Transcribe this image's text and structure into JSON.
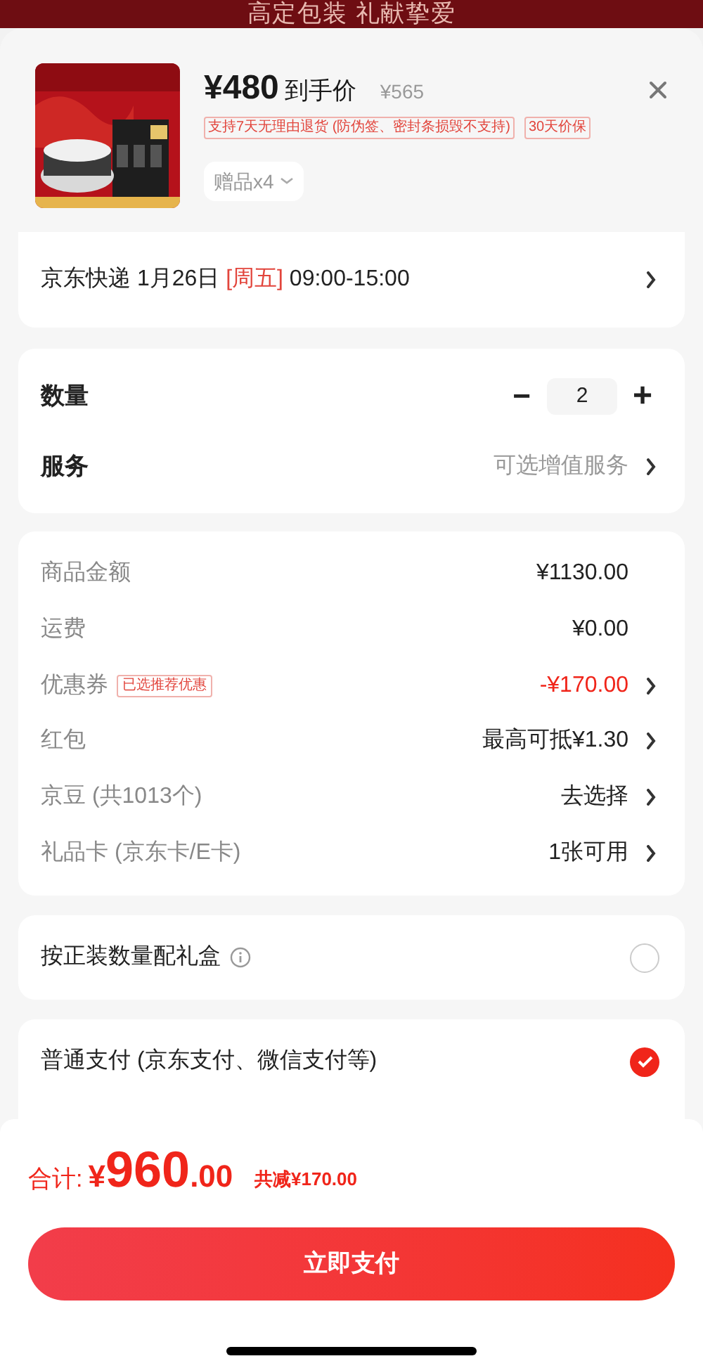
{
  "banner": {
    "title": "高定包装 礼献挚爱"
  },
  "product": {
    "price": "¥480",
    "price_label": "到手价",
    "original_price": "¥565",
    "tags": [
      "支持7天无理由退货 (防伪签、密封条损毁不支持)",
      "30天价保"
    ],
    "gifts": "赠品x4"
  },
  "delivery": {
    "carrier": "京东快递 1月26日",
    "weekday": "[周五]",
    "time": "09:00-15:00"
  },
  "quantity": {
    "label": "数量",
    "value": "2",
    "minus": "−",
    "plus": "+"
  },
  "service": {
    "label": "服务",
    "value": "可选增值服务"
  },
  "price_rows": [
    {
      "label": "商品金额",
      "value": "¥1130.00",
      "kind": "plain",
      "arrow": false
    },
    {
      "label": "运费",
      "value": "¥0.00",
      "kind": "plain",
      "arrow": false
    },
    {
      "label": "优惠券",
      "badge": "已选推荐优惠",
      "value": "-¥170.00",
      "kind": "discount",
      "arrow": true
    },
    {
      "label": "红包",
      "value": "最高可抵¥1.30",
      "kind": "plain",
      "arrow": true
    },
    {
      "label": "京豆 (共1013个)",
      "value": "去选择",
      "kind": "plain",
      "arrow": true
    },
    {
      "label": "礼品卡 (京东卡/E卡)",
      "value": "1张可用",
      "kind": "plain",
      "arrow": true
    }
  ],
  "gift_box": {
    "label": "按正装数量配礼盒",
    "checked": false
  },
  "payment_options": [
    {
      "label": "普通支付 (京东支付、微信支付等)",
      "selected": true
    }
  ],
  "footer": {
    "total_label": "合计:",
    "currency": "¥",
    "total_int": "960",
    "total_dec": ".00",
    "saved": "共减¥170.00",
    "pay_button": "立即支付"
  }
}
